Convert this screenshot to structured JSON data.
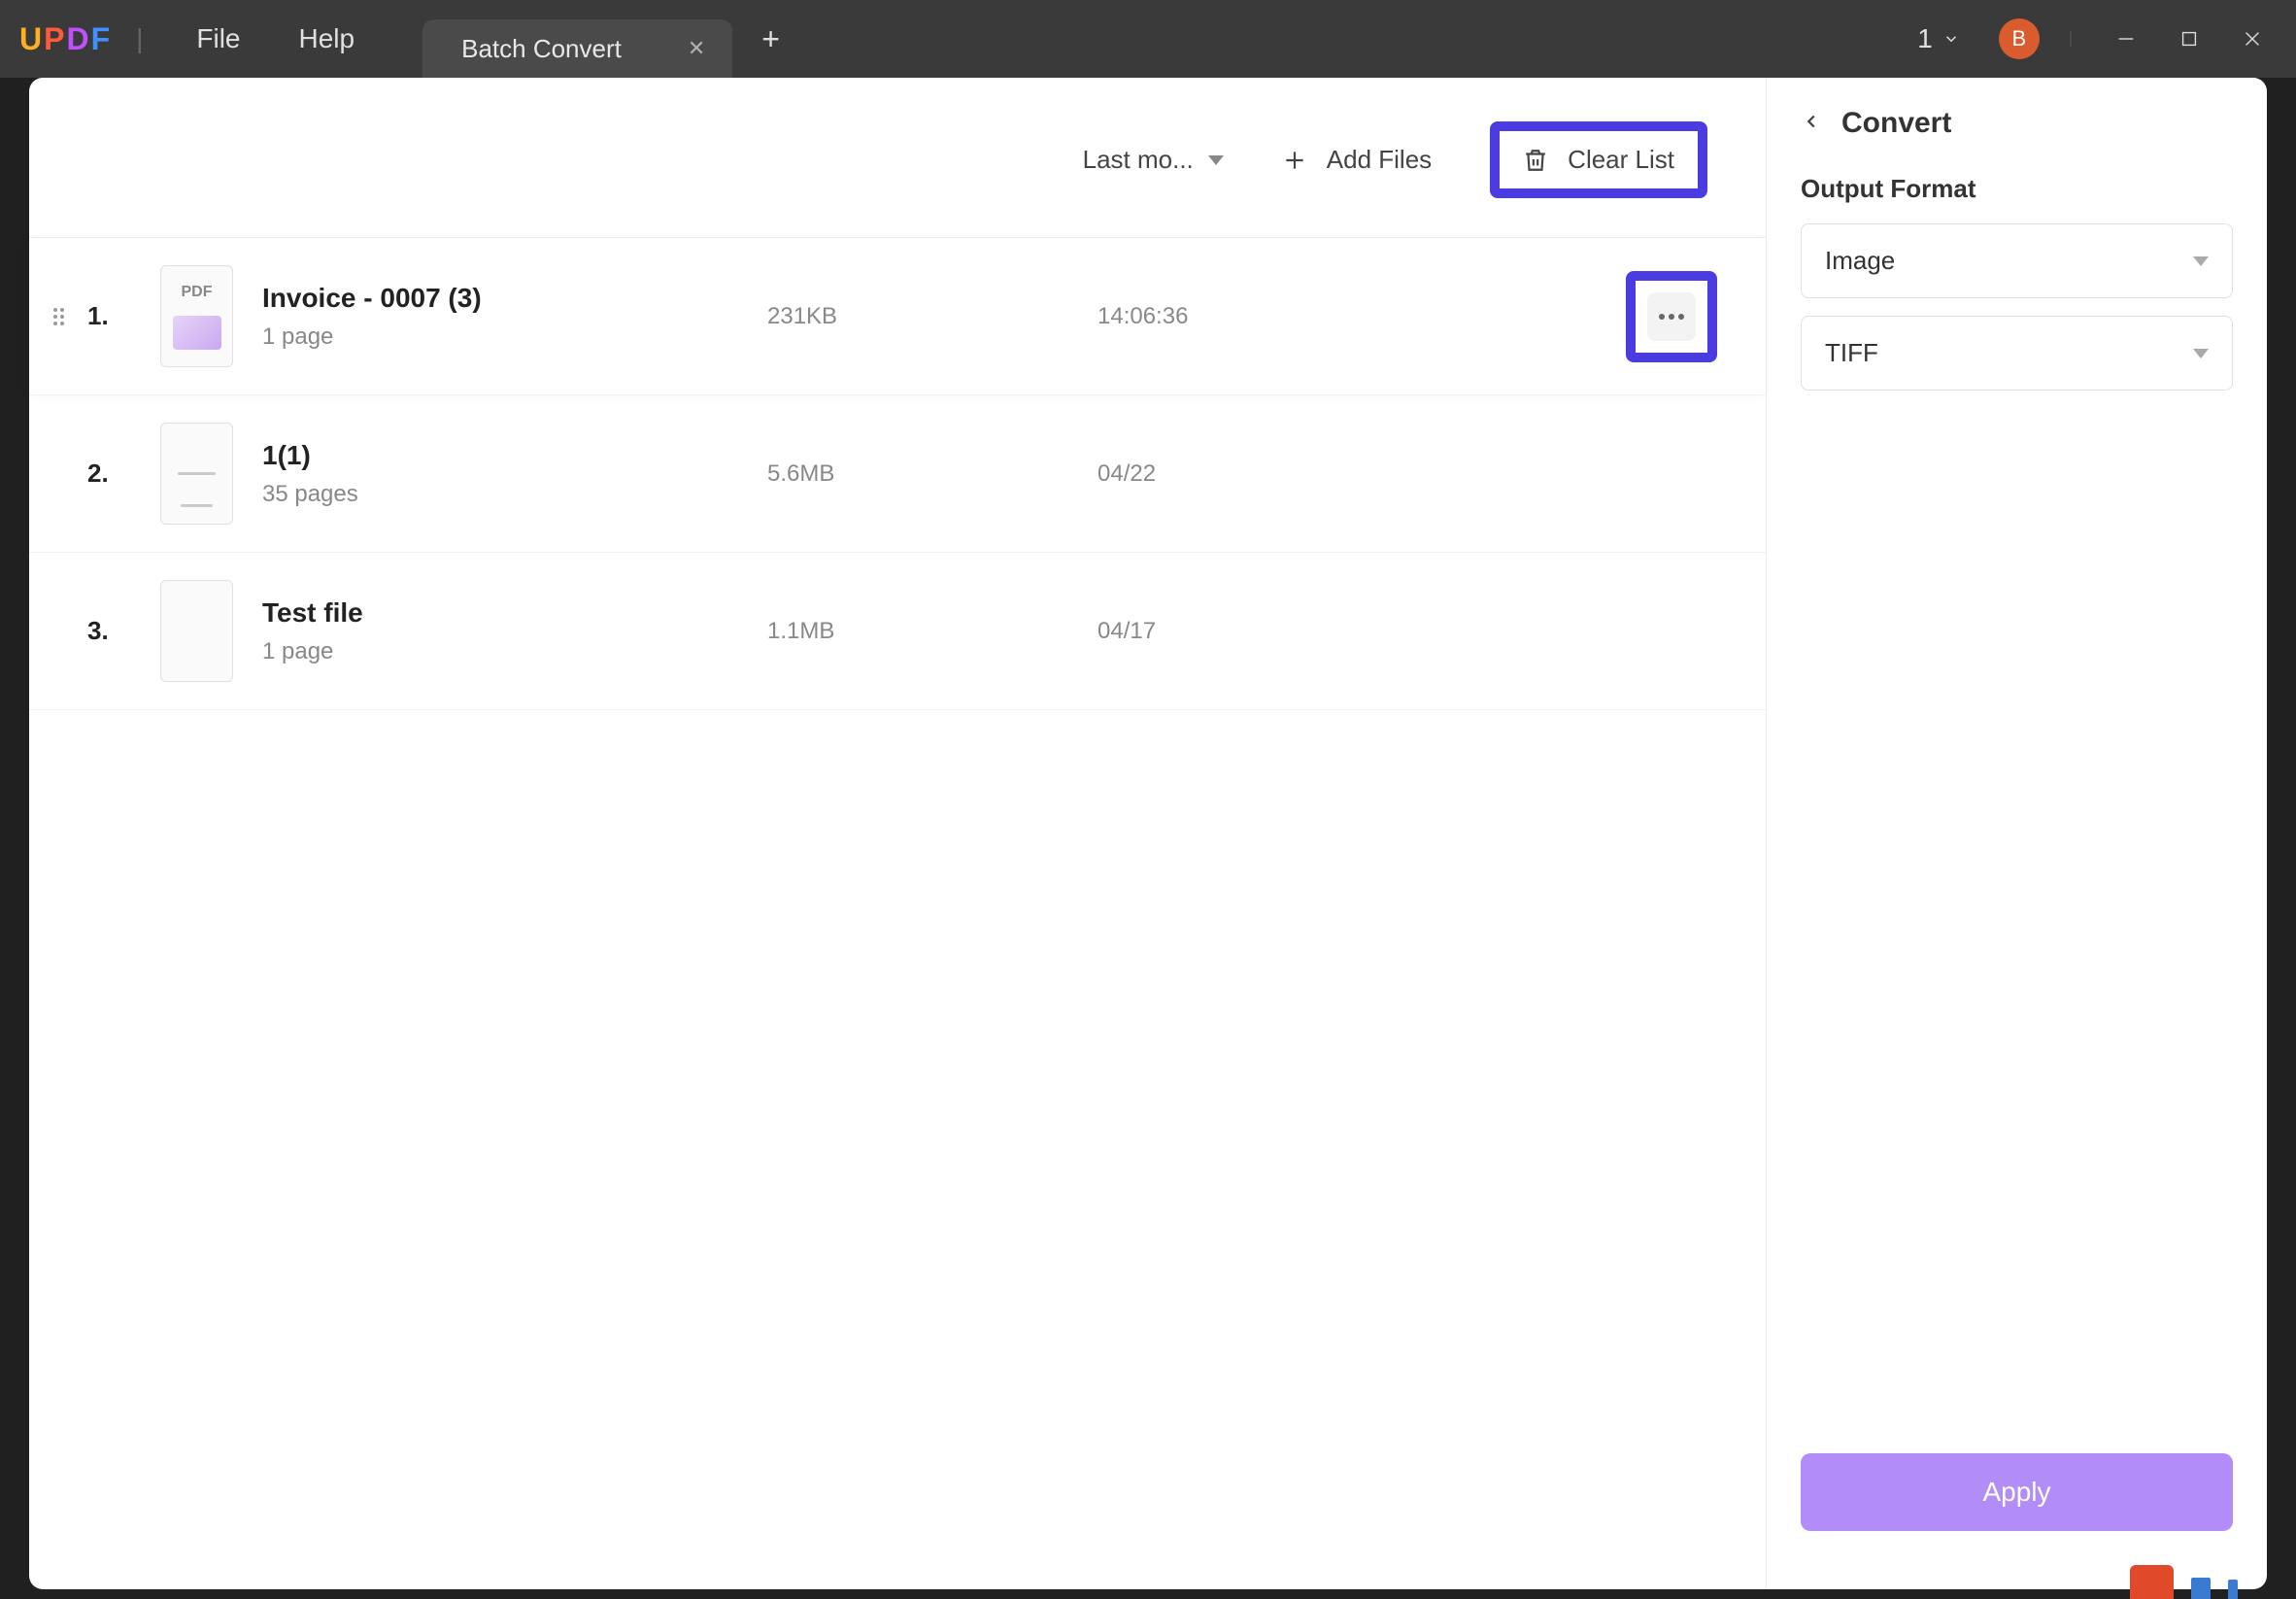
{
  "titlebar": {
    "menu_file": "File",
    "menu_help": "Help",
    "tab_title": "Batch Convert",
    "tab_count": "1",
    "avatar_initial": "B"
  },
  "toolbar": {
    "sort_label": "Last mo...",
    "add_files_label": "Add Files",
    "clear_list_label": "Clear List"
  },
  "files": [
    {
      "num": "1.",
      "title": "Invoice - 0007 (3)",
      "pages": "1 page",
      "size": "231KB",
      "date": "14:06:36",
      "selected": true,
      "thumbtype": "pdf"
    },
    {
      "num": "2.",
      "title": "1(1)",
      "pages": "35 pages",
      "size": "5.6MB",
      "date": "04/22",
      "selected": false,
      "thumbtype": "doc"
    },
    {
      "num": "3.",
      "title": "Test file",
      "pages": "1 page",
      "size": "1.1MB",
      "date": "04/17",
      "selected": false,
      "thumbtype": "pics"
    }
  ],
  "panel": {
    "title": "Convert",
    "section_title": "Output Format",
    "format_value": "Image",
    "subtype_value": "TIFF",
    "apply_label": "Apply"
  },
  "thumb_pdf_badge": "PDF"
}
